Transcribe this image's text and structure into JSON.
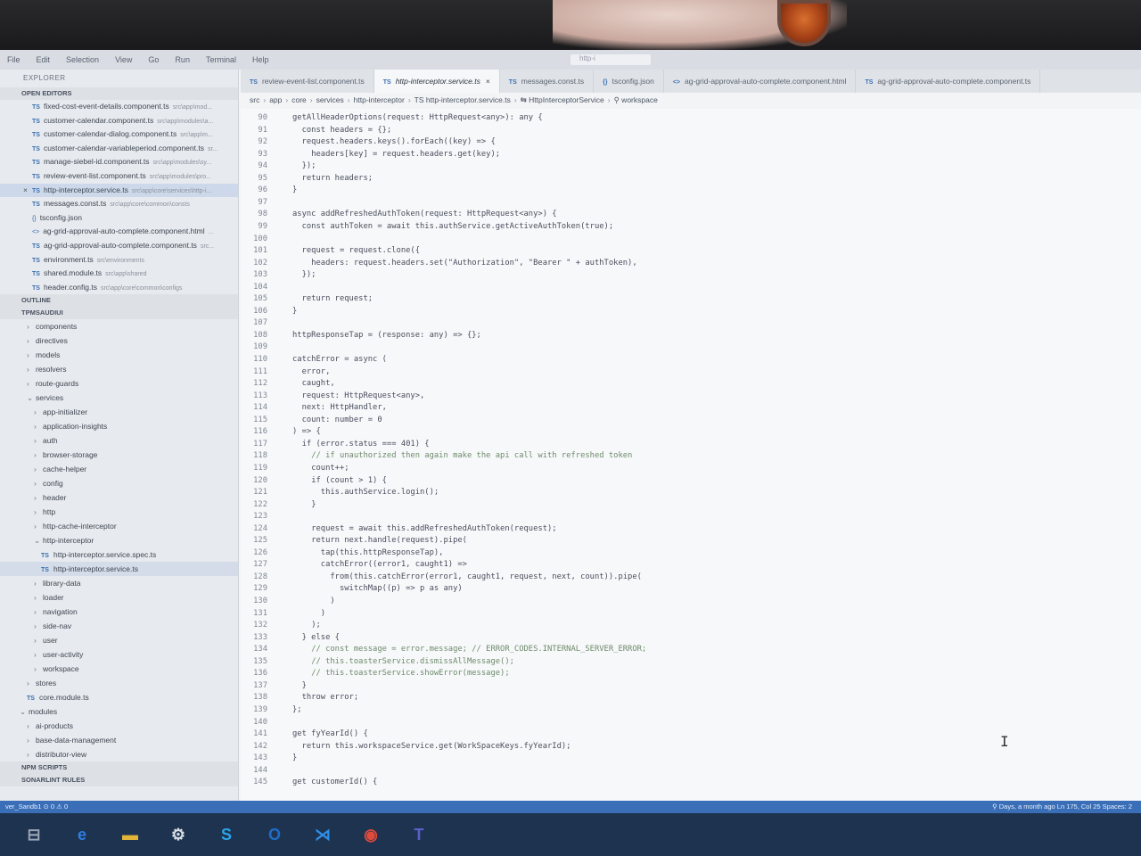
{
  "menu": [
    "File",
    "Edit",
    "Selection",
    "View",
    "Go",
    "Run",
    "Terminal",
    "Help"
  ],
  "search_text": "http-i",
  "explorer": {
    "title": "EXPLORER",
    "open_editors_label": "OPEN EDITORS",
    "open_editors": [
      {
        "icon": "TS",
        "name": "fixed-cost-event-details.component.ts",
        "path": "src\\app\\mod..."
      },
      {
        "icon": "TS",
        "name": "customer-calendar.component.ts",
        "path": "src\\app\\modules\\a..."
      },
      {
        "icon": "TS",
        "name": "customer-calendar-dialog.component.ts",
        "path": "src\\app\\m..."
      },
      {
        "icon": "TS",
        "name": "customer-calendar-variableperiod.component.ts",
        "path": "sr..."
      },
      {
        "icon": "TS",
        "name": "manage-siebel-id.component.ts",
        "path": "src\\app\\modules\\sy..."
      },
      {
        "icon": "TS",
        "name": "review-event-list.component.ts",
        "path": "src\\app\\modules\\pro..."
      },
      {
        "icon": "TS",
        "name": "http-interceptor.service.ts",
        "path": "src\\app\\core\\services\\http-i..."
      },
      {
        "icon": "TS",
        "name": "messages.const.ts",
        "path": "src\\app\\core\\common\\consts"
      },
      {
        "icon": "{}",
        "name": "tsconfig.json",
        "path": ""
      },
      {
        "icon": "<>",
        "name": "ag-grid-approval-auto-complete.component.html",
        "path": "..."
      },
      {
        "icon": "TS",
        "name": "ag-grid-approval-auto-complete.component.ts",
        "path": "src..."
      },
      {
        "icon": "TS",
        "name": "environment.ts",
        "path": "src\\environments"
      },
      {
        "icon": "TS",
        "name": "shared.module.ts",
        "path": "src\\app\\shared"
      },
      {
        "icon": "TS",
        "name": "header.config.ts",
        "path": "src\\app\\core\\common\\configs"
      }
    ],
    "outline_label": "OUTLINE",
    "project_label": "TPMSAUDIUI",
    "tree": [
      {
        "depth": 1,
        "chev": "›",
        "name": "components"
      },
      {
        "depth": 1,
        "chev": "›",
        "name": "directives"
      },
      {
        "depth": 1,
        "chev": "›",
        "name": "models"
      },
      {
        "depth": 1,
        "chev": "›",
        "name": "resolvers"
      },
      {
        "depth": 1,
        "chev": "›",
        "name": "route-guards"
      },
      {
        "depth": 1,
        "chev": "⌄",
        "name": "services"
      },
      {
        "depth": 2,
        "chev": "›",
        "name": "app-initializer"
      },
      {
        "depth": 2,
        "chev": "›",
        "name": "application-insights"
      },
      {
        "depth": 2,
        "chev": "›",
        "name": "auth"
      },
      {
        "depth": 2,
        "chev": "›",
        "name": "browser-storage"
      },
      {
        "depth": 2,
        "chev": "›",
        "name": "cache-helper"
      },
      {
        "depth": 2,
        "chev": "›",
        "name": "config"
      },
      {
        "depth": 2,
        "chev": "›",
        "name": "header"
      },
      {
        "depth": 2,
        "chev": "›",
        "name": "http"
      },
      {
        "depth": 2,
        "chev": "›",
        "name": "http-cache-interceptor"
      },
      {
        "depth": 2,
        "chev": "⌄",
        "name": "http-interceptor"
      },
      {
        "depth": 3,
        "chev": "TS",
        "name": "http-interceptor.service.spec.ts"
      },
      {
        "depth": 3,
        "chev": "TS",
        "name": "http-interceptor.service.ts"
      },
      {
        "depth": 2,
        "chev": "›",
        "name": "library-data"
      },
      {
        "depth": 2,
        "chev": "›",
        "name": "loader"
      },
      {
        "depth": 2,
        "chev": "›",
        "name": "navigation"
      },
      {
        "depth": 2,
        "chev": "›",
        "name": "side-nav"
      },
      {
        "depth": 2,
        "chev": "›",
        "name": "user"
      },
      {
        "depth": 2,
        "chev": "›",
        "name": "user-activity"
      },
      {
        "depth": 2,
        "chev": "›",
        "name": "workspace"
      },
      {
        "depth": 1,
        "chev": "›",
        "name": "stores"
      },
      {
        "depth": 1,
        "chev": "TS",
        "name": "core.module.ts"
      },
      {
        "depth": 0,
        "chev": "⌄",
        "name": "modules"
      },
      {
        "depth": 1,
        "chev": "›",
        "name": "ai-products"
      },
      {
        "depth": 1,
        "chev": "›",
        "name": "base-data-management"
      },
      {
        "depth": 1,
        "chev": "›",
        "name": "distributor-view"
      }
    ],
    "npm_scripts_label": "NPM SCRIPTS",
    "sonarlint_label": "SONARLINT RULES"
  },
  "tabs": [
    {
      "icon": "TS",
      "label": "review-event-list.component.ts",
      "active": false
    },
    {
      "icon": "TS",
      "label": "http-interceptor.service.ts",
      "active": true,
      "close": "×"
    },
    {
      "icon": "TS",
      "label": "messages.const.ts",
      "active": false
    },
    {
      "icon": "{}",
      "label": "tsconfig.json",
      "active": false
    },
    {
      "icon": "<>",
      "label": "ag-grid-approval-auto-complete.component.html",
      "active": false
    },
    {
      "icon": "TS",
      "label": "ag-grid-approval-auto-complete.component.ts",
      "active": false
    }
  ],
  "breadcrumbs": [
    "src",
    "app",
    "core",
    "services",
    "http-interceptor",
    "TS http-interceptor.service.ts",
    "⇆ HttpInterceptorService",
    "⚲ workspace"
  ],
  "code": [
    {
      "n": "90",
      "indent": 0,
      "text": "getAllHeaderOptions(request: HttpRequest<any>): any {"
    },
    {
      "n": "91",
      "indent": 1,
      "text": "const headers = {};"
    },
    {
      "n": "92",
      "indent": 1,
      "text": "request.headers.keys().forEach((key) => {"
    },
    {
      "n": "93",
      "indent": 2,
      "text": "headers[key] = request.headers.get(key);"
    },
    {
      "n": "94",
      "indent": 1,
      "text": "});"
    },
    {
      "n": "95",
      "indent": 1,
      "text": "return headers;"
    },
    {
      "n": "96",
      "indent": 0,
      "text": "}"
    },
    {
      "n": "97",
      "indent": 0,
      "text": ""
    },
    {
      "n": "98",
      "indent": 0,
      "text": "async addRefreshedAuthToken(request: HttpRequest<any>) {"
    },
    {
      "n": "99",
      "indent": 1,
      "text": "const authToken = await this.authService.getActiveAuthToken(true);"
    },
    {
      "n": "100",
      "indent": 0,
      "text": ""
    },
    {
      "n": "101",
      "indent": 1,
      "text": "request = request.clone({"
    },
    {
      "n": "102",
      "indent": 2,
      "text": "headers: request.headers.set(\"Authorization\", \"Bearer \" + authToken),"
    },
    {
      "n": "103",
      "indent": 1,
      "text": "});"
    },
    {
      "n": "104",
      "indent": 0,
      "text": ""
    },
    {
      "n": "105",
      "indent": 1,
      "text": "return request;"
    },
    {
      "n": "106",
      "indent": 0,
      "text": "}"
    },
    {
      "n": "107",
      "indent": 0,
      "text": ""
    },
    {
      "n": "108",
      "indent": 0,
      "text": "httpResponseTap = (response: any) => {};"
    },
    {
      "n": "109",
      "indent": 0,
      "text": ""
    },
    {
      "n": "110",
      "indent": 0,
      "text": "catchError = async ("
    },
    {
      "n": "111",
      "indent": 1,
      "text": "error,"
    },
    {
      "n": "112",
      "indent": 1,
      "text": "caught,"
    },
    {
      "n": "113",
      "indent": 1,
      "text": "request: HttpRequest<any>,"
    },
    {
      "n": "114",
      "indent": 1,
      "text": "next: HttpHandler,"
    },
    {
      "n": "115",
      "indent": 1,
      "text": "count: number = 0"
    },
    {
      "n": "116",
      "indent": 0,
      "text": ") => {"
    },
    {
      "n": "117",
      "indent": 1,
      "text": "if (error.status === 401) {"
    },
    {
      "n": "118",
      "indent": 2,
      "text": "// if unauthorized then again make the api call with refreshed token"
    },
    {
      "n": "119",
      "indent": 2,
      "text": "count++;"
    },
    {
      "n": "120",
      "indent": 2,
      "text": "if (count > 1) {"
    },
    {
      "n": "121",
      "indent": 3,
      "text": "this.authService.login();"
    },
    {
      "n": "122",
      "indent": 2,
      "text": "}"
    },
    {
      "n": "123",
      "indent": 0,
      "text": ""
    },
    {
      "n": "124",
      "indent": 2,
      "text": "request = await this.addRefreshedAuthToken(request);"
    },
    {
      "n": "125",
      "indent": 2,
      "text": "return next.handle(request).pipe("
    },
    {
      "n": "126",
      "indent": 3,
      "text": "tap(this.httpResponseTap),"
    },
    {
      "n": "127",
      "indent": 3,
      "text": "catchError((error1, caught1) =>"
    },
    {
      "n": "128",
      "indent": 4,
      "text": "from(this.catchError(error1, caught1, request, next, count)).pipe("
    },
    {
      "n": "129",
      "indent": 5,
      "text": "switchMap((p) => p as any)"
    },
    {
      "n": "130",
      "indent": 4,
      "text": ")"
    },
    {
      "n": "131",
      "indent": 3,
      "text": ")"
    },
    {
      "n": "132",
      "indent": 2,
      "text": ");"
    },
    {
      "n": "133",
      "indent": 1,
      "text": "} else {"
    },
    {
      "n": "134",
      "indent": 2,
      "text": "// const message = error.message; // ERROR_CODES.INTERNAL_SERVER_ERROR;"
    },
    {
      "n": "135",
      "indent": 2,
      "text": "// this.toasterService.dismissAllMessage();"
    },
    {
      "n": "136",
      "indent": 2,
      "text": "// this.toasterService.showError(message);"
    },
    {
      "n": "137",
      "indent": 1,
      "text": "}"
    },
    {
      "n": "138",
      "indent": 1,
      "text": "throw error;"
    },
    {
      "n": "139",
      "indent": 0,
      "text": "};"
    },
    {
      "n": "140",
      "indent": 0,
      "text": ""
    },
    {
      "n": "141",
      "indent": 0,
      "text": "get fyYearId() {"
    },
    {
      "n": "142",
      "indent": 1,
      "text": "return this.workspaceService.get(WorkSpaceKeys.fyYearId);"
    },
    {
      "n": "143",
      "indent": 0,
      "text": "}"
    },
    {
      "n": "144",
      "indent": 0,
      "text": ""
    },
    {
      "n": "145",
      "indent": 0,
      "text": "get customerId() {"
    }
  ],
  "status": {
    "left": "ver_Sandb1  ⊙ 0 ⚠ 0",
    "right": "⚲ Days, a month ago   Ln 175, Col 25   Spaces: 2"
  },
  "taskbar": [
    {
      "name": "task-view-icon",
      "glyph": "⊟",
      "color": "#9aa4b4"
    },
    {
      "name": "edge-icon",
      "glyph": "e",
      "color": "#2f7ee0"
    },
    {
      "name": "file-explorer-icon",
      "glyph": "▬",
      "color": "#e2b43a"
    },
    {
      "name": "settings-icon",
      "glyph": "⚙",
      "color": "#d8dde6"
    },
    {
      "name": "skype-icon",
      "glyph": "S",
      "color": "#2aa6e8"
    },
    {
      "name": "outlook-icon",
      "glyph": "O",
      "color": "#1f6dc8"
    },
    {
      "name": "vscode-icon",
      "glyph": "⋊",
      "color": "#2e8ee6"
    },
    {
      "name": "chrome-icon",
      "glyph": "◉",
      "color": "#e04a3a"
    },
    {
      "name": "teams-icon",
      "glyph": "T",
      "color": "#5b5fc7"
    }
  ]
}
